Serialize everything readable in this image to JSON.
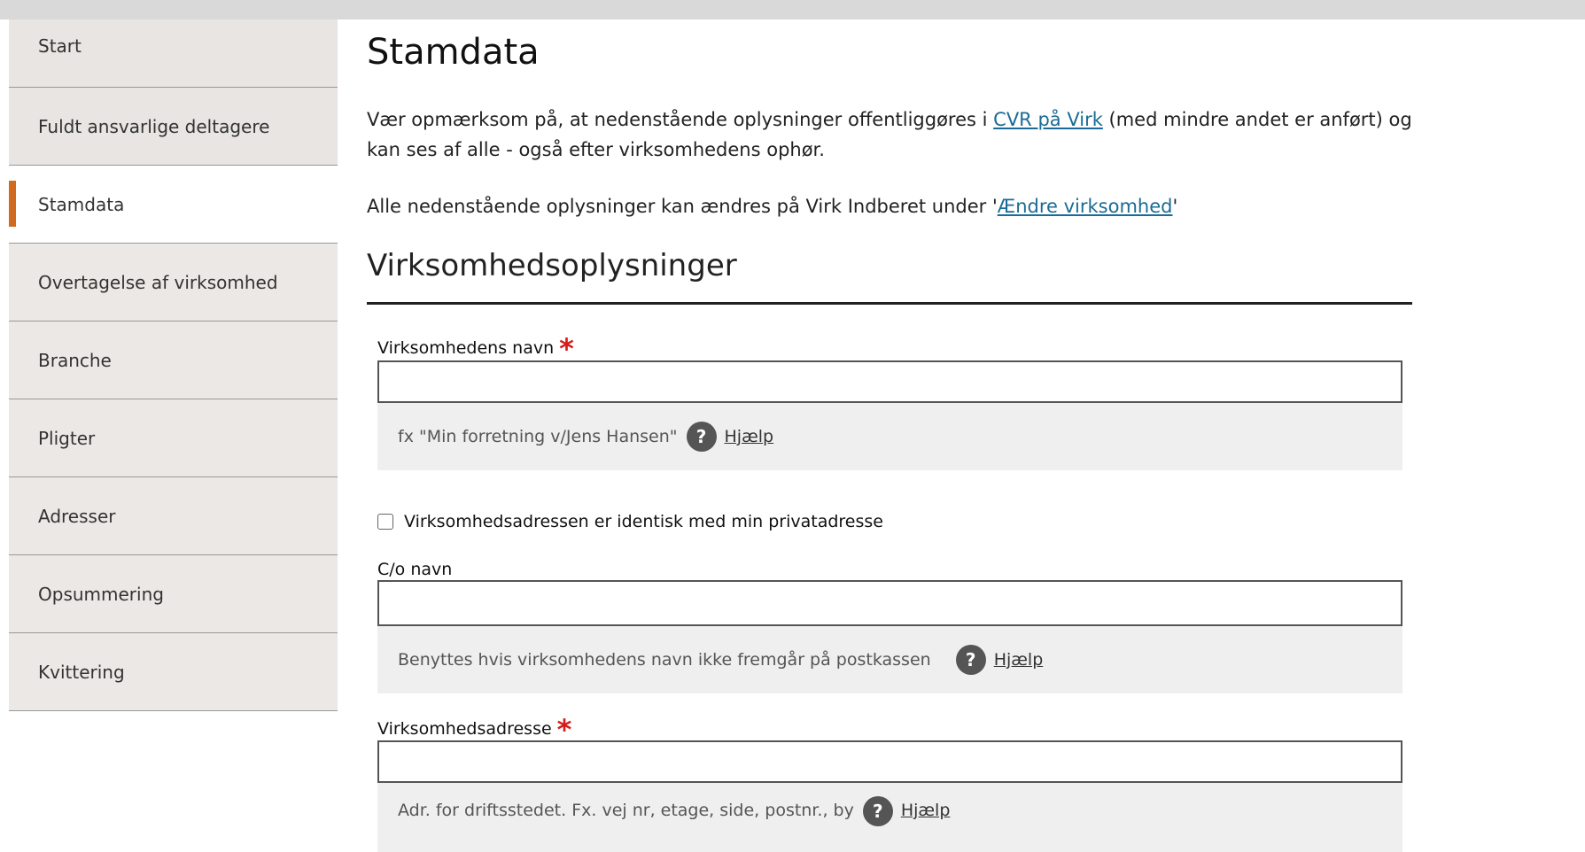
{
  "sidebar": {
    "items": [
      {
        "label": "Start"
      },
      {
        "label": "Fuldt ansvarlige deltagere"
      },
      {
        "label": "Stamdata"
      },
      {
        "label": "Overtagelse af virksomhed"
      },
      {
        "label": "Branche"
      },
      {
        "label": "Pligter"
      },
      {
        "label": "Adresser"
      },
      {
        "label": "Opsummering"
      },
      {
        "label": "Kvittering"
      }
    ]
  },
  "main": {
    "title": "Stamdata",
    "intro_before": "Vær opmærksom på, at nedenstående oplysninger offentliggøres i ",
    "intro_link": "CVR på Virk",
    "intro_after": " (med mindre andet er anført) og kan ses af alle - også efter virksomhedens ophør.",
    "change_before": "Alle nedenstående oplysninger kan ændres på Virk Indberet under '",
    "change_link": "Ændre virksomhed",
    "change_after": "'",
    "section_title": "Virksomhedsoplysninger",
    "fields": {
      "name_label": "Virksomhedens navn",
      "name_hint": "fx \"Min forretning v/Jens Hansen\"",
      "checkbox_label": "Virksomhedsadressen er identisk med min privatadresse",
      "co_label": "C/o navn",
      "co_hint": "Benyttes hvis virksomhedens navn ikke fremgår på postkassen",
      "address_label": "Virksomhedsadresse",
      "address_hint": "Adr. for driftsstedet. Fx. vej nr, etage, side, postnr., by",
      "help_label": "Hjælp",
      "required_mark": "*"
    }
  },
  "colors": {
    "active_marker": "#d06a1f",
    "link": "#1b6b96",
    "required": "#d61b1b"
  },
  "icons": {
    "help": "question-circle-icon"
  }
}
